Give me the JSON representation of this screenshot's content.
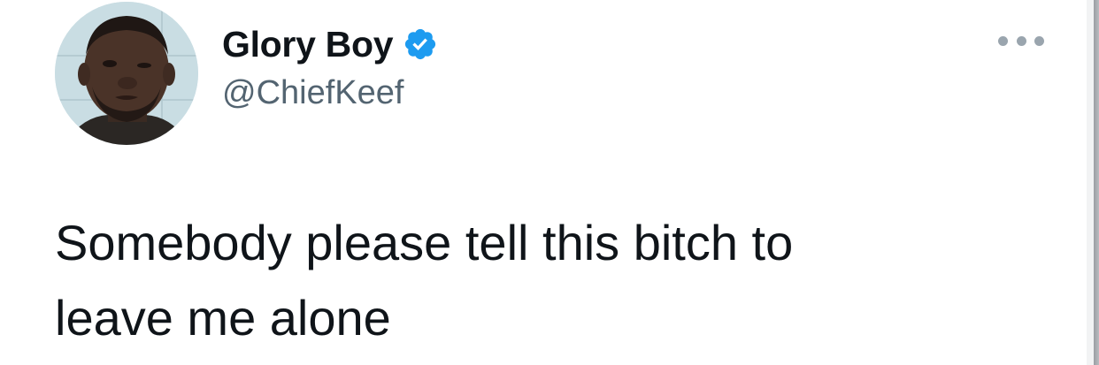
{
  "tweet": {
    "author": {
      "display_name": "Glory Boy",
      "handle": "@ChiefKeef",
      "verified": true,
      "avatar_icon": "profile-photo"
    },
    "more_icon": "more-horizontal-icon",
    "verified_icon": "verified-badge-icon",
    "text": "Somebody please tell this bitch to\nleave me alone"
  },
  "colors": {
    "text_primary": "#0f1419",
    "text_secondary": "#536471",
    "verified_blue": "#1d9bf0",
    "more_dots": "#9aa5ae",
    "background": "#ffffff"
  }
}
